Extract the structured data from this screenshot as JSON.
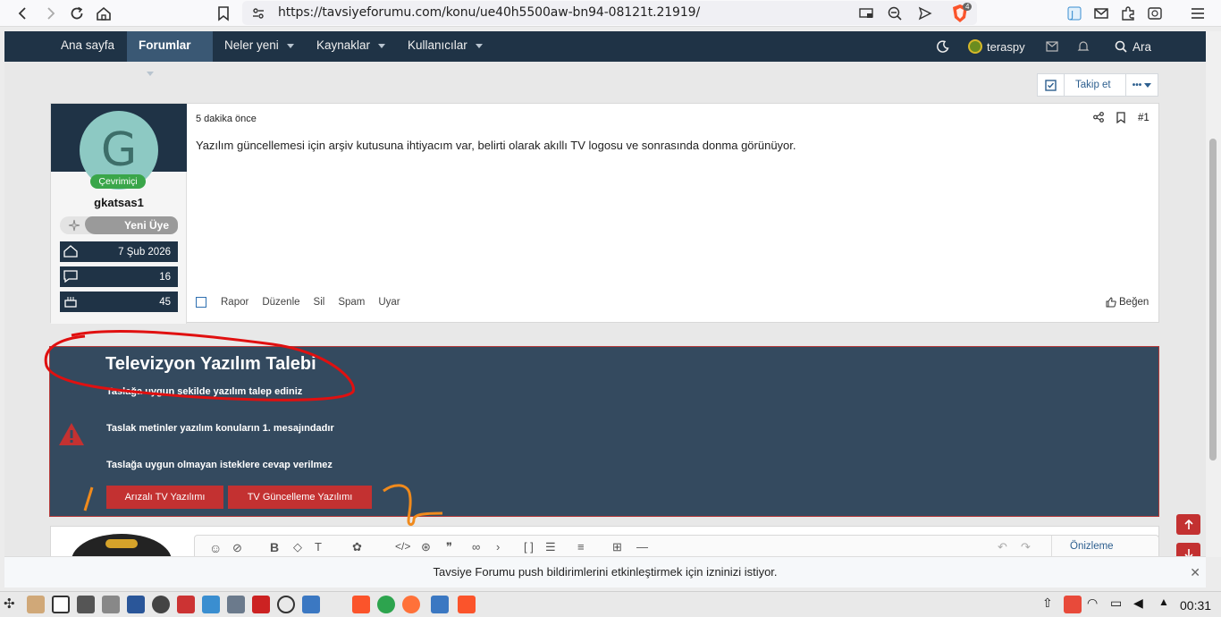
{
  "browser": {
    "url": "https://tavsiyeforumu.com/konu/ue40h5500aw-bn94-08121t.21919/",
    "shield_badge": "4"
  },
  "nav": {
    "items": [
      "Ana sayfa",
      "Forumlar",
      "Neler yeni",
      "Kaynaklar",
      "Kullanıcılar"
    ],
    "user": "teraspy",
    "search": "Ara"
  },
  "thread_tools": {
    "follow": "Takip et",
    "more": "•••"
  },
  "post": {
    "date": "5 dakika önce",
    "number": "#1",
    "body": "Yazılım güncellemesi için arşiv kutusuna ihtiyacım var, belirti olarak akıllı TV logosu ve sonrasında donma görünüyor.",
    "actions": [
      "Rapor",
      "Düzenle",
      "Sil",
      "Spam",
      "Uyar"
    ],
    "like": "Beğen"
  },
  "author": {
    "initial": "G",
    "status": "Çevrimiçi",
    "name": "gkatsas1",
    "rank": "Yeni Üye",
    "joined": "7 Şub 2026",
    "messages": "16",
    "points": "45"
  },
  "notice": {
    "title": "Televizyon Yazılım Talebi",
    "line1": "Taslağa uygun şekilde yazılım talep ediniz",
    "line2": "Taslak metinler yazılım konuların 1. mesajındadır",
    "line3": "Taslağa uygun olmayan isteklere cevap verilmez",
    "buttons": [
      "Arızalı TV Yazılımı",
      "TV Güncelleme Yazılımı"
    ]
  },
  "editor": {
    "preview": "Önizleme"
  },
  "push_bar": {
    "text": "Tavsiye Forumu push bildirimlerini etkinleştirmek için izninizi istiyor."
  },
  "taskbar": {
    "clock": "00:31"
  },
  "colors": {
    "nav_bg": "#1f3346",
    "notice_bg": "#344a5f",
    "red_button": "#c33131",
    "online_badge": "#3aa64a",
    "avatar_bg": "#8dc9c3",
    "annotation_red": "#e01010",
    "annotation_orange": "#f08a1c"
  }
}
